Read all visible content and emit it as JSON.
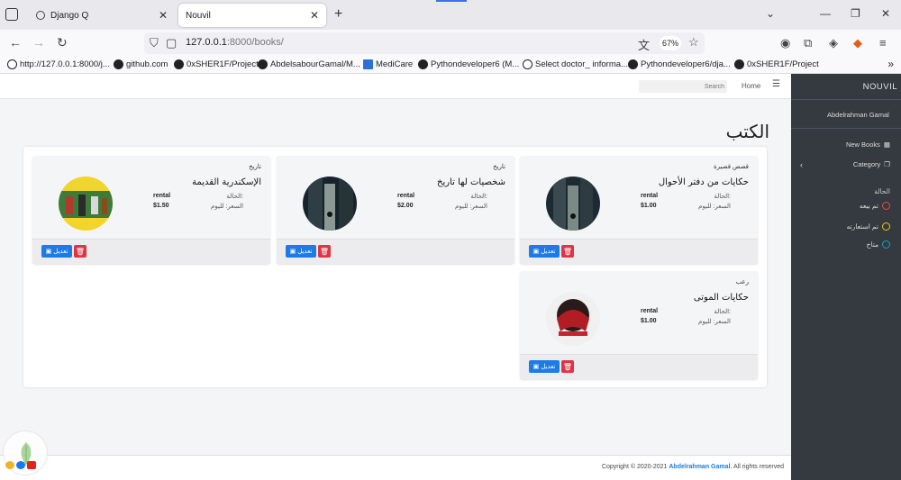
{
  "browser": {
    "tabs": [
      {
        "title": "Django Q",
        "active": false
      },
      {
        "title": "Nouvil",
        "active": true
      }
    ],
    "url_host": "127.0.0.1",
    "url_rest": ":8000/books/",
    "zoom": "67%",
    "bookmarks": [
      "http://127.0.0.1:8000/j...",
      "github.com",
      "0xSHER1F/Project",
      "AbdelsabourGamal/M...",
      "MediCare",
      "Pythondeveloper6 (M...",
      "Select doctor_ informa...",
      "Pythondeveloper6/dja...",
      "0xSHER1F/Project"
    ]
  },
  "appbar": {
    "search_placeholder": "Search",
    "home": "Home"
  },
  "sidebar": {
    "brand": "NOUVIL",
    "user": "Abdelrahman Gamal",
    "new_books": "New Books",
    "category": "Category",
    "status_header": "الحالة",
    "statuses": [
      {
        "label": "تم بيعه",
        "color": "#e74c3c"
      },
      {
        "label": "تم استعارته",
        "color": "#f1c40f"
      },
      {
        "label": "متاح",
        "color": "#17a2b8"
      }
    ]
  },
  "page": {
    "title": "الكتب"
  },
  "labels": {
    "status": "الحالة:",
    "price": "السعر: لليوم",
    "edit": "تعديل"
  },
  "books": [
    {
      "category": "قصص قصيرة",
      "title": "حكايات من دفتر الأحوال",
      "status": "rental",
      "price": "$1.00"
    },
    {
      "category": "تاريخ",
      "title": "شخصيات لها تاريخ",
      "status": "rental",
      "price": "$2.00"
    },
    {
      "category": "تاريخ",
      "title": "الإسكندرية القديمة",
      "status": "rental",
      "price": "$1.50"
    },
    {
      "category": "رعب",
      "title": "حكايات الموتى",
      "status": "rental",
      "price": "$1.00"
    }
  ],
  "footer": {
    "prefix": "Copyright © 2020-2021",
    "author": "Abdelrahman Gamal.",
    "suffix": "All rights reserved"
  },
  "colors": {
    "edit_button": "#1e7be6",
    "delete_button": "#dc3545",
    "sidebar_bg": "#343a40"
  }
}
